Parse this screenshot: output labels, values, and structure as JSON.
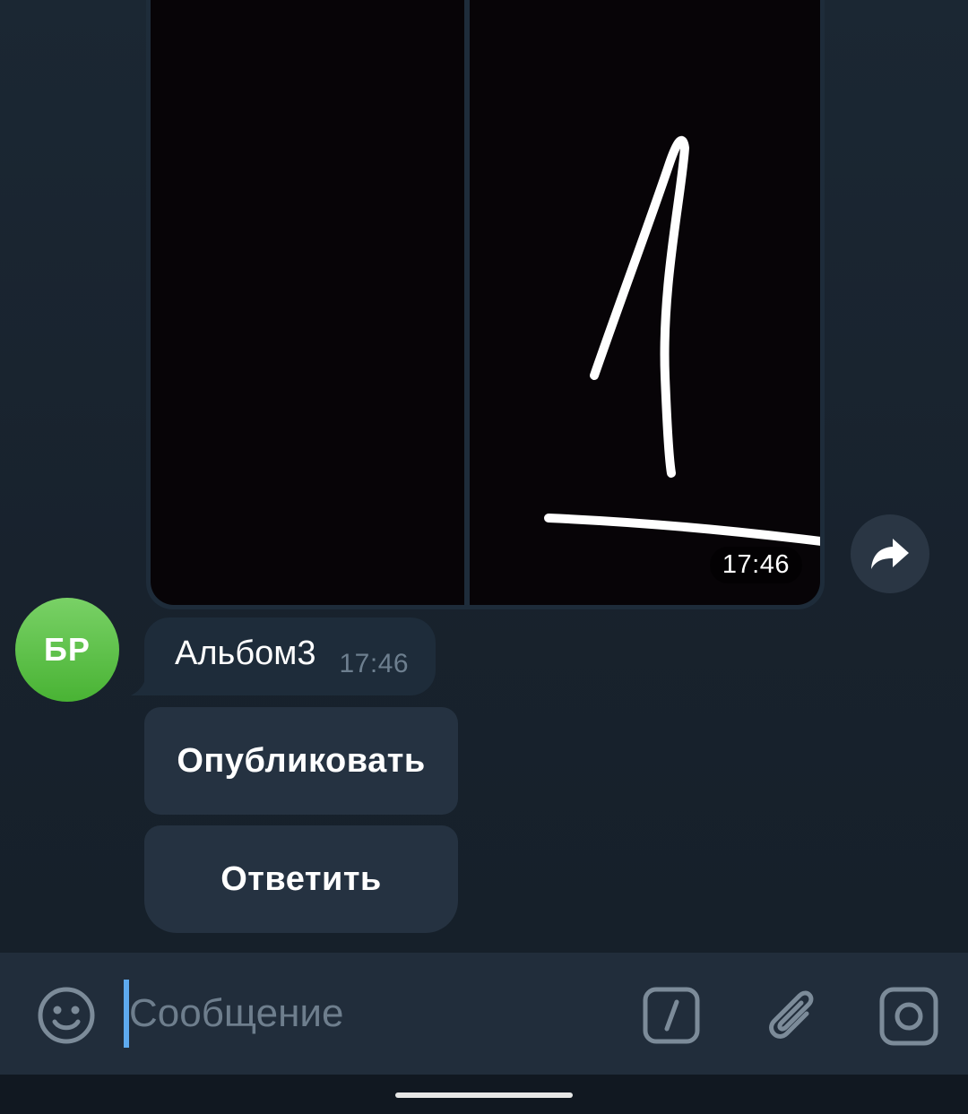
{
  "album": {
    "time": "17:46"
  },
  "message": {
    "sender_initials": "БР",
    "text": "Альбом3",
    "time": "17:46"
  },
  "inline_buttons": {
    "publish_label": "Опубликовать",
    "reply_label": "Ответить"
  },
  "input": {
    "placeholder": "Сообщение"
  },
  "icons": {
    "forward": "forward-arrow-icon",
    "emoji": "smile-icon",
    "commands": "slash-command-icon",
    "attach": "paperclip-icon",
    "camera": "camera-icon"
  },
  "colors": {
    "background": "#17212b",
    "bubble": "#1e2c3a",
    "button": "#253241",
    "avatar": "#5cbf47",
    "accent": "#5eaaef"
  }
}
